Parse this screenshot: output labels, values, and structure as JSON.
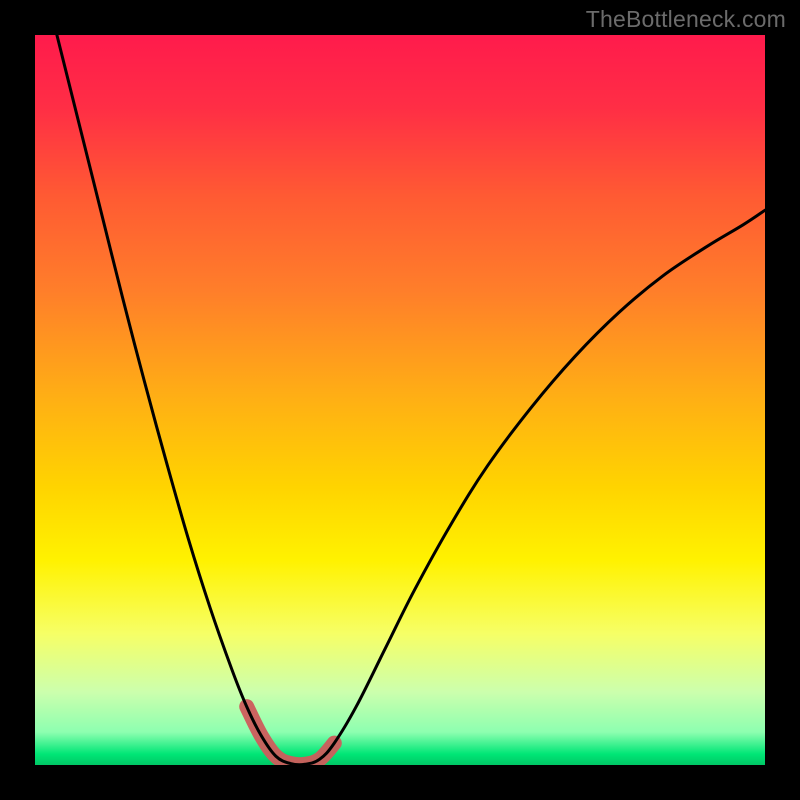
{
  "watermark": "TheBottleneck.com",
  "gradient": {
    "stops": [
      {
        "offset": 0.0,
        "color": "#ff1b4c"
      },
      {
        "offset": 0.1,
        "color": "#ff2e45"
      },
      {
        "offset": 0.22,
        "color": "#ff5a33"
      },
      {
        "offset": 0.35,
        "color": "#ff7e2a"
      },
      {
        "offset": 0.5,
        "color": "#ffb014"
      },
      {
        "offset": 0.62,
        "color": "#ffd400"
      },
      {
        "offset": 0.72,
        "color": "#fff200"
      },
      {
        "offset": 0.82,
        "color": "#f6ff66"
      },
      {
        "offset": 0.9,
        "color": "#ccffad"
      },
      {
        "offset": 0.955,
        "color": "#8dffb0"
      },
      {
        "offset": 0.985,
        "color": "#00e676"
      },
      {
        "offset": 1.0,
        "color": "#00c765"
      }
    ]
  },
  "curve_style": {
    "stroke": "#000000",
    "width": 3
  },
  "highlight_style": {
    "stroke": "#cd5c5c",
    "width": 15,
    "linecap": "round",
    "linejoin": "round"
  },
  "chart_data": {
    "type": "line",
    "title": "",
    "xlabel": "",
    "ylabel": "",
    "xlim": [
      0,
      1
    ],
    "ylim": [
      0,
      1
    ],
    "grid": false,
    "legend": false,
    "series": [
      {
        "name": "curve",
        "x": [
          0.03,
          0.06,
          0.09,
          0.12,
          0.15,
          0.18,
          0.21,
          0.24,
          0.27,
          0.29,
          0.31,
          0.33,
          0.35,
          0.37,
          0.39,
          0.41,
          0.44,
          0.48,
          0.52,
          0.57,
          0.62,
          0.68,
          0.74,
          0.8,
          0.86,
          0.92,
          0.97,
          1.0
        ],
        "y": [
          1.0,
          0.88,
          0.76,
          0.64,
          0.525,
          0.415,
          0.31,
          0.215,
          0.13,
          0.08,
          0.04,
          0.012,
          0.002,
          0.001,
          0.008,
          0.03,
          0.08,
          0.16,
          0.24,
          0.33,
          0.41,
          0.49,
          0.56,
          0.62,
          0.67,
          0.71,
          0.74,
          0.76
        ]
      }
    ],
    "highlight_region": {
      "series": "curve",
      "x_start": 0.29,
      "x_end": 0.41
    },
    "notes": "Axes and units are not displayed in the source image; x and y are normalized to the visible plot area (0 at left/bottom, 1 at right/top). Values are read from pixel positions and rounded to ~3 decimals."
  }
}
